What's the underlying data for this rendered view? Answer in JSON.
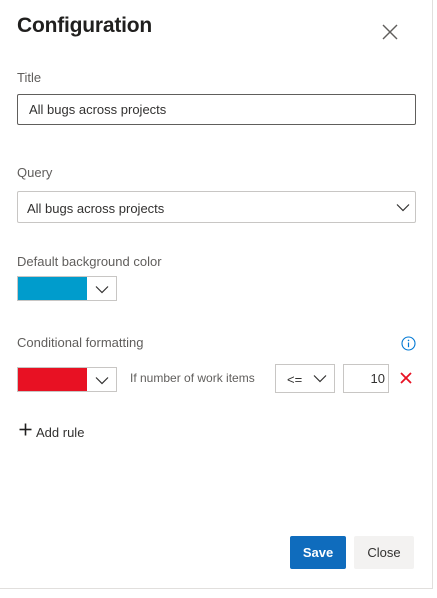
{
  "dialog": {
    "title": "Configuration"
  },
  "title_field": {
    "label": "Title",
    "value": "All bugs across projects"
  },
  "query_field": {
    "label": "Query",
    "selected": "All bugs across projects"
  },
  "background": {
    "label": "Default background color",
    "color": "#009ccc"
  },
  "conditional": {
    "label": "Conditional formatting",
    "rules": [
      {
        "color": "#e81123",
        "condition_text": "If number of work items",
        "operator": "<=",
        "value": "10"
      }
    ],
    "add_rule_label": "Add rule"
  },
  "footer": {
    "save_label": "Save",
    "close_label": "Close"
  },
  "colors": {
    "accent": "#0f6cbd",
    "delete": "#e81123",
    "info": "#0078d4"
  }
}
